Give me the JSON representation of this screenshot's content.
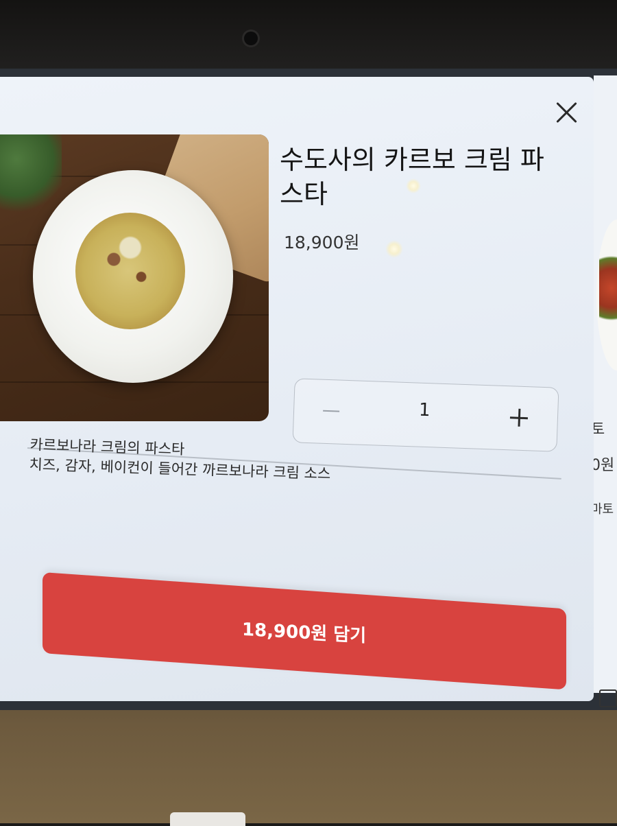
{
  "product": {
    "name": "수도사의 카르보 크림 파스타",
    "price": "18,900원",
    "description_lines": [
      "카르보나라 크림의 파스타",
      "치즈, 감자, 베이컨이 들어간 까르보나라 크림 소스"
    ]
  },
  "quantity": {
    "value": "1",
    "decrement_icon": "minus-icon",
    "increment_icon": "plus-icon"
  },
  "actions": {
    "close_icon": "close-icon",
    "add_to_cart_label": "18,900원 담기"
  },
  "background_panel": {
    "peek_texts": [
      "토",
      "0원",
      "마토"
    ]
  },
  "colors": {
    "accent": "#d8433f",
    "modal_background": "#e9eef5"
  }
}
